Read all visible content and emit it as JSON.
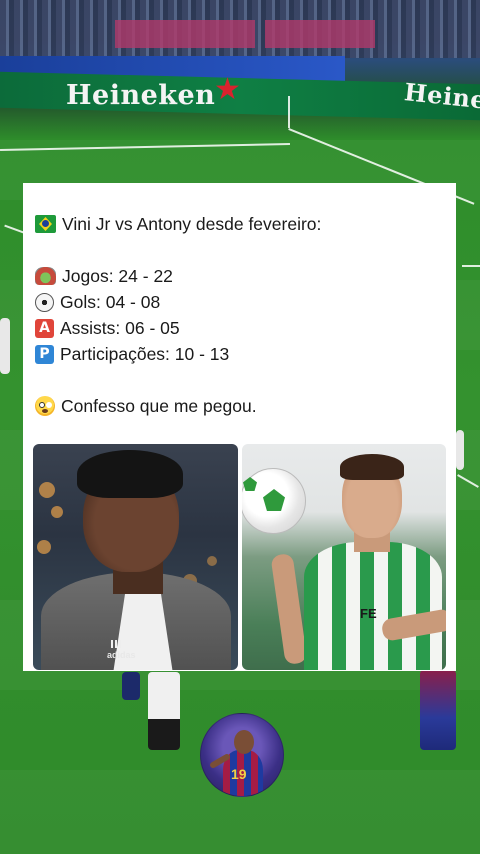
{
  "background": {
    "ad_brand_left": "Heineken",
    "ad_brand_right": "Heineken",
    "colors": {
      "pitch": "#2f8a2a",
      "ad_board": "#0f7f44",
      "brand_star": "#d9232e"
    }
  },
  "post": {
    "lines": [
      {
        "icon": "brazil-flag-icon",
        "text": "Vini Jr vs Antony desde fevereiro:"
      },
      {
        "icon": "stadium-icon",
        "text": "Jogos: 24 - 22"
      },
      {
        "icon": "soccer-ball-icon",
        "text": "Gols: 04 - 08"
      },
      {
        "icon": "letter-a-icon",
        "text": "Assists: 06 - 05",
        "icon_glyph": "A"
      },
      {
        "icon": "letter-p-icon",
        "text": "Participações: 10 - 13",
        "icon_glyph": "P"
      },
      {
        "icon": "flushed-face-icon",
        "text": "Confesso que me pegou."
      }
    ],
    "photos": [
      {
        "name": "vini-jr-photo",
        "jacket_brand": "adidas"
      },
      {
        "name": "antony-photo",
        "shirt_sponsor": "FE"
      }
    ]
  },
  "avatar": {
    "shirt_number": "19"
  }
}
